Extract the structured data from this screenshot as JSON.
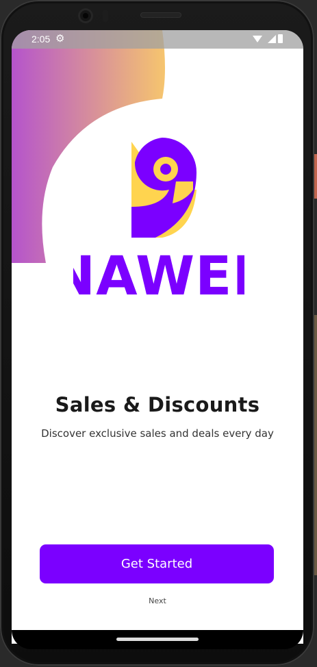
{
  "status_bar": {
    "time": "2:05"
  },
  "brand": {
    "name": "NAWEL"
  },
  "onboarding": {
    "title": "Sales & Discounts",
    "subtitle": "Discover exclusive sales and deals every day",
    "primary_button": "Get Started",
    "secondary_link": "Next"
  },
  "colors": {
    "primary": "#7b00ff",
    "accent_yellow": "#ffd44f",
    "gradient_start": "#b24fd0",
    "gradient_end": "#f6c56e"
  }
}
